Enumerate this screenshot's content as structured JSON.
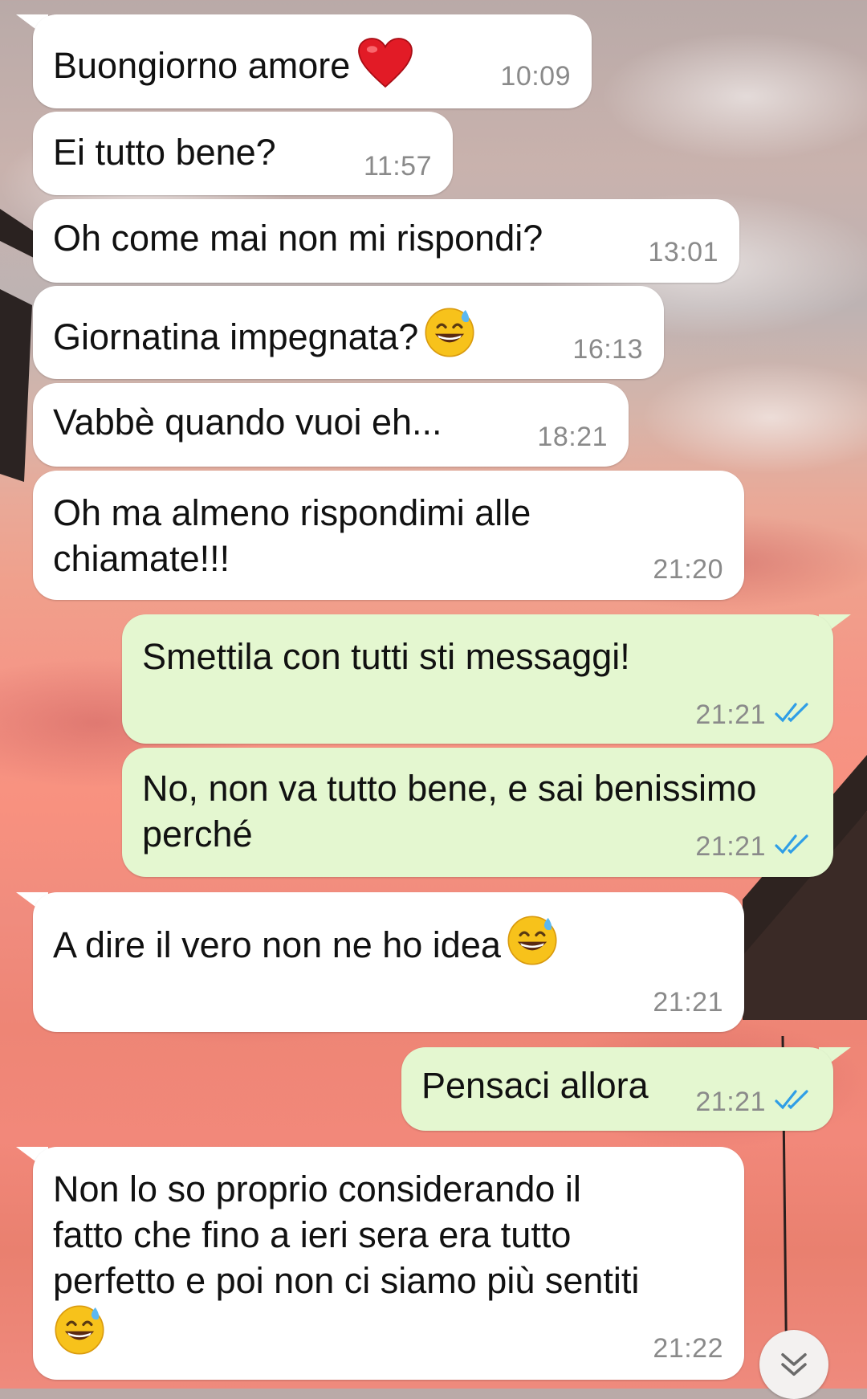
{
  "colors": {
    "incoming_bubble": "#ffffff",
    "outgoing_bubble": "#e4f7d0",
    "read_ticks": "#2f9ee6",
    "timestamp": "#8a8a8a"
  },
  "messages": [
    {
      "direction": "incoming",
      "text": "Buongiorno amore",
      "emoji": "red-heart",
      "time": "10:09"
    },
    {
      "direction": "incoming",
      "text": "Ei tutto bene?",
      "time": "11:57"
    },
    {
      "direction": "incoming",
      "text": "Oh come mai non mi rispondi?",
      "time": "13:01"
    },
    {
      "direction": "incoming",
      "text": "Giornatina impegnata?",
      "emoji": "grinning-sweat",
      "time": "16:13"
    },
    {
      "direction": "incoming",
      "text": "Vabbè quando vuoi eh...",
      "time": "18:21"
    },
    {
      "direction": "incoming",
      "text": "Oh ma almeno rispondimi alle\nchiamate!!!",
      "time": "21:20"
    },
    {
      "direction": "outgoing",
      "text": "Smettila con tutti sti messaggi!",
      "time": "21:21",
      "status": "read"
    },
    {
      "direction": "outgoing",
      "text": "No, non va tutto bene, e sai benissimo\nperché",
      "time": "21:21",
      "status": "read"
    },
    {
      "direction": "incoming",
      "text": "A dire il vero non ne ho idea",
      "emoji": "grinning-sweat",
      "time": "21:21"
    },
    {
      "direction": "outgoing",
      "text": "Pensaci allora",
      "time": "21:21",
      "status": "read"
    },
    {
      "direction": "incoming",
      "text": "Non lo so proprio considerando il\nfatto che fino a ieri sera era tutto\nperfetto e poi non ci siamo più sentiti",
      "emoji": "grinning-sweat",
      "time": "21:22"
    }
  ],
  "scroll_button": {
    "icon": "double-chevron-down-icon"
  }
}
